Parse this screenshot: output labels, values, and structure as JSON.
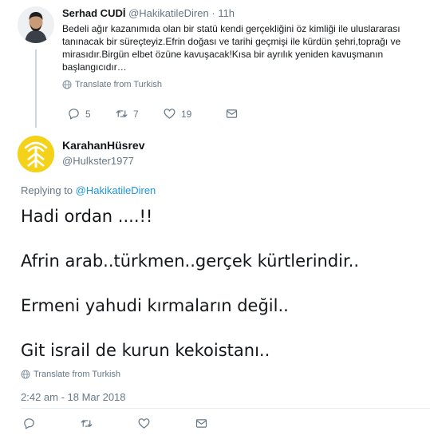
{
  "parent_tweet": {
    "name": "Serhad CUDİ",
    "handle": "@HakikatileDiren",
    "separator": "·",
    "time": "11h",
    "text": "Bedeli ağır kazanımıda olan bir statü kendi gerçekliğini öz kimliği ile uluslararası tanınacak bir süreçteyiz.Efrin doğası ve tarihi geçmişi ile kürdün şehri,toprağı ve mirasıdır.Birgün elbet özüne kavuşacak!Kısa bir ayrılık yeniden kavuşmanın başlangıcıdır…",
    "translate_label": "Translate from Turkish",
    "actions": {
      "replies": "5",
      "retweets": "7",
      "likes": "19"
    }
  },
  "main_tweet": {
    "name": "KarahanHüsrev",
    "handle": "@Hulkster1977",
    "replying_prefix": "Replying to",
    "replying_to": "@HakikatileDiren",
    "lines": [
      "Hadi ordan ....!!",
      "Afrin arab..türkmen..gerçek kürtlerindir..",
      "Ermeni yahudi kırmaların değil..",
      "Git israil de kurun kekoistanı.."
    ],
    "translate_label": "Translate from Turkish",
    "timestamp": "2:42 am - 18 Mar 2018"
  },
  "colors": {
    "link": "#1b95e0",
    "secondary_text": "#657786",
    "avatar_yellow": "#f5d21a"
  },
  "icons": [
    "reply-icon",
    "retweet-icon",
    "like-icon",
    "message-icon",
    "globe-icon",
    "verified-logo-icon"
  ]
}
